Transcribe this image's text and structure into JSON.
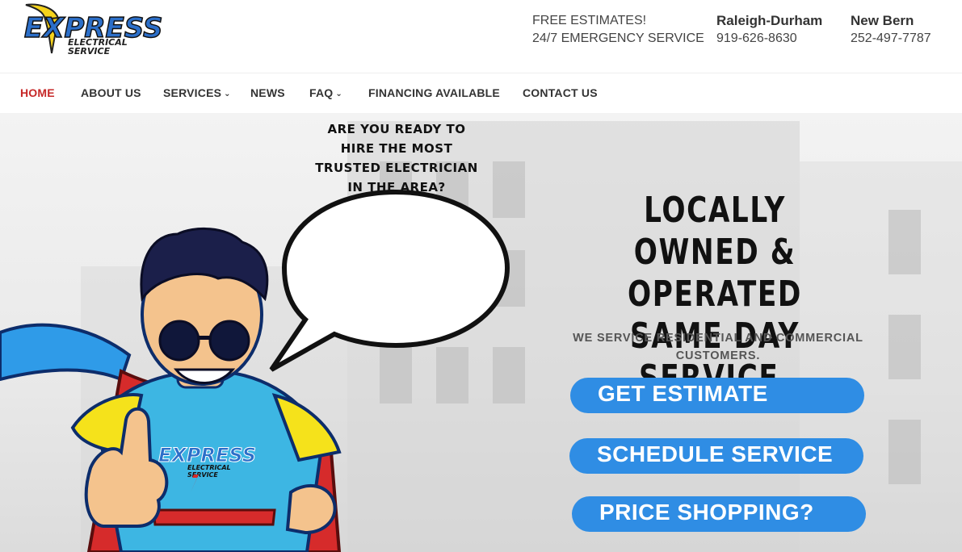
{
  "logo": {
    "word": "EXPRESS",
    "sub1": "ELECTRICAL",
    "sub2": "SERVICE"
  },
  "header": {
    "block1": {
      "line1": "FREE ESTIMATES!",
      "line2": "24/7 EMERGENCY SERVICE"
    },
    "block2": {
      "city": "Raleigh-Durham",
      "phone": "919-626-8630"
    },
    "block3": {
      "city": "New Bern",
      "phone": "252-497-7787"
    }
  },
  "nav": {
    "home": "HOME",
    "about": "ABOUT US",
    "services": "SERVICES",
    "news": "NEWS",
    "faq": "FAQ",
    "financing": "FINANCING AVAILABLE",
    "contact": "CONTACT US",
    "chevron": "❯"
  },
  "hero": {
    "bubble": [
      "ARE YOU READY TO",
      "HIRE THE MOST",
      "TRUSTED ELECTRICIAN",
      "IN THE AREA?"
    ],
    "headline": [
      "LOCALLY OWNED &",
      "OPERATED",
      "SAME DAY SERVICE."
    ],
    "subline": [
      "WE SERVICE RESIDENTIAL AND COMMERCIAL",
      "CUSTOMERS."
    ],
    "cta1": "GET ESTIMATE",
    "cta2": "SCHEDULE SERVICE",
    "cta3": "PRICE SHOPPING?",
    "chest_logo": {
      "word": "EXPRESS",
      "sub1": "ELECTRICAL",
      "sub2": "SERVICE"
    }
  },
  "colors": {
    "active_nav": "#c62828",
    "cta_blue": "#2f8de4",
    "logo_blue": "#2c6fc9",
    "logo_yellow": "#f5d31b"
  }
}
